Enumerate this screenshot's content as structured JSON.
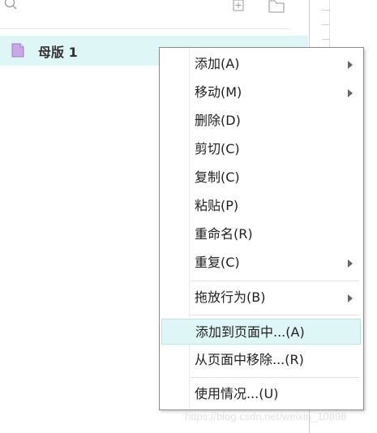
{
  "panel": {
    "master_name": "母版 1"
  },
  "context_menu": {
    "items": [
      {
        "label": "添加(A)",
        "has_submenu": true
      },
      {
        "label": "移动(M)",
        "has_submenu": true
      },
      {
        "label": "删除(D)",
        "has_submenu": false
      },
      {
        "label": "剪切(C)",
        "has_submenu": false
      },
      {
        "label": "复制(C)",
        "has_submenu": false
      },
      {
        "label": "粘贴(P)",
        "has_submenu": false
      },
      {
        "label": "重命名(R)",
        "has_submenu": false
      },
      {
        "label": "重复(C)",
        "has_submenu": true
      },
      {
        "label": "拖放行为(B)",
        "has_submenu": true
      },
      {
        "label": "添加到页面中...(A)",
        "has_submenu": false,
        "highlighted": true
      },
      {
        "label": "从页面中移除...(R)",
        "has_submenu": false
      },
      {
        "label": "使用情况...(U)",
        "has_submenu": false
      }
    ]
  },
  "watermark": "https://blog.csdn.net/weixin_10898",
  "icons": {
    "search": "search-icon",
    "add": "add-page-icon",
    "folder": "folder-icon",
    "master": "master-page-icon"
  },
  "colors": {
    "selection": "#dff6f7",
    "master_icon": "#c9a8e6"
  }
}
